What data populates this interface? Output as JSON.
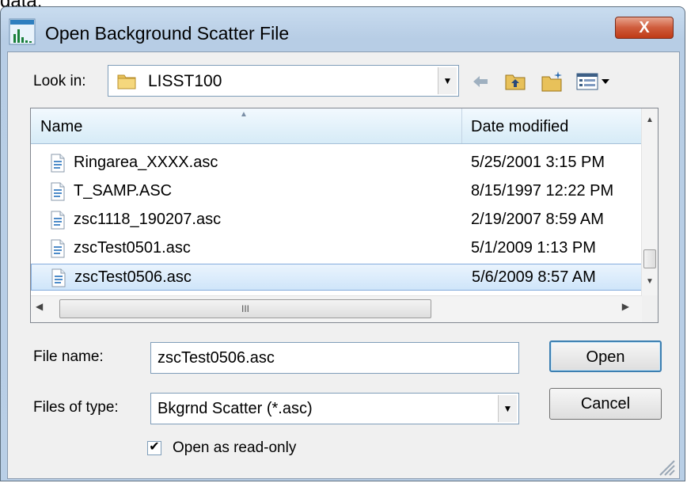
{
  "cut_off_text": "data.",
  "window": {
    "title": "Open Background Scatter File",
    "close_label": "X"
  },
  "look_in": {
    "label": "Look in:",
    "value": "LISST100"
  },
  "columns": {
    "name": "Name",
    "date": "Date modified"
  },
  "files": [
    {
      "name": "Ringarea_XXXX.asc",
      "date": "5/25/2001 3:15 PM",
      "selected": false
    },
    {
      "name": "T_SAMP.ASC",
      "date": "8/15/1997 12:22 PM",
      "selected": false
    },
    {
      "name": "zsc1118_190207.asc",
      "date": "2/19/2007 8:59 AM",
      "selected": false
    },
    {
      "name": "zscTest0501.asc",
      "date": "5/1/2009 1:13 PM",
      "selected": false
    },
    {
      "name": "zscTest0506.asc",
      "date": "5/6/2009 8:57 AM",
      "selected": true
    }
  ],
  "scroll": {
    "thumb_grip": "III"
  },
  "file_name": {
    "label": "File name:",
    "value": "zscTest0506.asc"
  },
  "file_type": {
    "label": "Files of type:",
    "value": "Bkgrnd Scatter (*.asc)"
  },
  "buttons": {
    "open": "Open",
    "cancel": "Cancel"
  },
  "read_only": {
    "label": "Open as read-only",
    "checked": true
  },
  "icons": [
    "app-icon",
    "folder-icon",
    "back-arrow-icon",
    "up-folder-icon",
    "new-folder-icon",
    "view-menu-icon",
    "file-icon",
    "size-grip-icon"
  ],
  "colors": {
    "title_bar": "#c4d8ee",
    "close_button": "#cf5c3c",
    "selection": "#cfe5fa",
    "default_button_border": "#3c7fb1"
  }
}
